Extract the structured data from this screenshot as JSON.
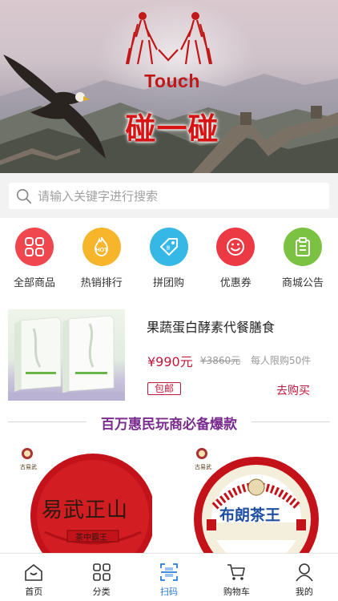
{
  "banner": {
    "brand_en": "Touch",
    "brand_cn": "碰一碰"
  },
  "search": {
    "placeholder": "请输入关键字进行搜索",
    "icon": "search-icon"
  },
  "categories": [
    {
      "label": "全部商品",
      "icon": "grid-icon",
      "color": "#f0464e"
    },
    {
      "label": "热销排行",
      "icon": "hot-icon",
      "color": "#f7b52c"
    },
    {
      "label": "拼团购",
      "icon": "tag-icon",
      "color": "#35b8e6"
    },
    {
      "label": "优惠券",
      "icon": "smile-icon",
      "color": "#ec3a45"
    },
    {
      "label": "商城公告",
      "icon": "clipboard-icon",
      "color": "#7cc242"
    }
  ],
  "product": {
    "name": "果蔬蛋白酵素代餐膳食",
    "price": "¥990元",
    "original_price": "¥3860元",
    "limit": "每人限购50件",
    "tag": "包邮",
    "buy_label": "去购买"
  },
  "section": {
    "title": "百万惠民玩商必备爆款"
  },
  "tea_products": [
    {
      "brand": "古易武",
      "label": "易武正山",
      "sub": "茶中霸王"
    },
    {
      "brand": "古易武",
      "label": "布朗茶王",
      "sub": ""
    }
  ],
  "tabbar": {
    "items": [
      {
        "label": "首页",
        "icon": "home-icon"
      },
      {
        "label": "分类",
        "icon": "category-icon"
      },
      {
        "label": "扫码",
        "icon": "scan-icon"
      },
      {
        "label": "购物车",
        "icon": "cart-icon"
      },
      {
        "label": "我的",
        "icon": "user-icon"
      }
    ],
    "active_index": 2,
    "active_color": "#2b7bd6"
  },
  "colors": {
    "accent": "#c0183a",
    "section_title": "#7a2c8e"
  }
}
